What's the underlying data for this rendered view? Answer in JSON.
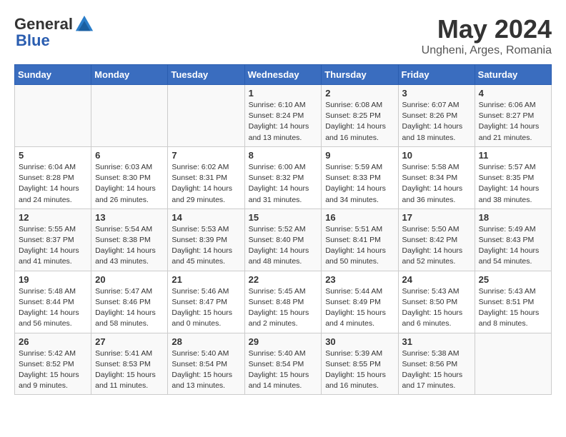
{
  "logo": {
    "general": "General",
    "blue": "Blue"
  },
  "title": "May 2024",
  "location": "Ungheni, Arges, Romania",
  "headers": [
    "Sunday",
    "Monday",
    "Tuesday",
    "Wednesday",
    "Thursday",
    "Friday",
    "Saturday"
  ],
  "weeks": [
    [
      {
        "num": "",
        "info": ""
      },
      {
        "num": "",
        "info": ""
      },
      {
        "num": "",
        "info": ""
      },
      {
        "num": "1",
        "info": "Sunrise: 6:10 AM\nSunset: 8:24 PM\nDaylight: 14 hours\nand 13 minutes."
      },
      {
        "num": "2",
        "info": "Sunrise: 6:08 AM\nSunset: 8:25 PM\nDaylight: 14 hours\nand 16 minutes."
      },
      {
        "num": "3",
        "info": "Sunrise: 6:07 AM\nSunset: 8:26 PM\nDaylight: 14 hours\nand 18 minutes."
      },
      {
        "num": "4",
        "info": "Sunrise: 6:06 AM\nSunset: 8:27 PM\nDaylight: 14 hours\nand 21 minutes."
      }
    ],
    [
      {
        "num": "5",
        "info": "Sunrise: 6:04 AM\nSunset: 8:28 PM\nDaylight: 14 hours\nand 24 minutes."
      },
      {
        "num": "6",
        "info": "Sunrise: 6:03 AM\nSunset: 8:30 PM\nDaylight: 14 hours\nand 26 minutes."
      },
      {
        "num": "7",
        "info": "Sunrise: 6:02 AM\nSunset: 8:31 PM\nDaylight: 14 hours\nand 29 minutes."
      },
      {
        "num": "8",
        "info": "Sunrise: 6:00 AM\nSunset: 8:32 PM\nDaylight: 14 hours\nand 31 minutes."
      },
      {
        "num": "9",
        "info": "Sunrise: 5:59 AM\nSunset: 8:33 PM\nDaylight: 14 hours\nand 34 minutes."
      },
      {
        "num": "10",
        "info": "Sunrise: 5:58 AM\nSunset: 8:34 PM\nDaylight: 14 hours\nand 36 minutes."
      },
      {
        "num": "11",
        "info": "Sunrise: 5:57 AM\nSunset: 8:35 PM\nDaylight: 14 hours\nand 38 minutes."
      }
    ],
    [
      {
        "num": "12",
        "info": "Sunrise: 5:55 AM\nSunset: 8:37 PM\nDaylight: 14 hours\nand 41 minutes."
      },
      {
        "num": "13",
        "info": "Sunrise: 5:54 AM\nSunset: 8:38 PM\nDaylight: 14 hours\nand 43 minutes."
      },
      {
        "num": "14",
        "info": "Sunrise: 5:53 AM\nSunset: 8:39 PM\nDaylight: 14 hours\nand 45 minutes."
      },
      {
        "num": "15",
        "info": "Sunrise: 5:52 AM\nSunset: 8:40 PM\nDaylight: 14 hours\nand 48 minutes."
      },
      {
        "num": "16",
        "info": "Sunrise: 5:51 AM\nSunset: 8:41 PM\nDaylight: 14 hours\nand 50 minutes."
      },
      {
        "num": "17",
        "info": "Sunrise: 5:50 AM\nSunset: 8:42 PM\nDaylight: 14 hours\nand 52 minutes."
      },
      {
        "num": "18",
        "info": "Sunrise: 5:49 AM\nSunset: 8:43 PM\nDaylight: 14 hours\nand 54 minutes."
      }
    ],
    [
      {
        "num": "19",
        "info": "Sunrise: 5:48 AM\nSunset: 8:44 PM\nDaylight: 14 hours\nand 56 minutes."
      },
      {
        "num": "20",
        "info": "Sunrise: 5:47 AM\nSunset: 8:46 PM\nDaylight: 14 hours\nand 58 minutes."
      },
      {
        "num": "21",
        "info": "Sunrise: 5:46 AM\nSunset: 8:47 PM\nDaylight: 15 hours\nand 0 minutes."
      },
      {
        "num": "22",
        "info": "Sunrise: 5:45 AM\nSunset: 8:48 PM\nDaylight: 15 hours\nand 2 minutes."
      },
      {
        "num": "23",
        "info": "Sunrise: 5:44 AM\nSunset: 8:49 PM\nDaylight: 15 hours\nand 4 minutes."
      },
      {
        "num": "24",
        "info": "Sunrise: 5:43 AM\nSunset: 8:50 PM\nDaylight: 15 hours\nand 6 minutes."
      },
      {
        "num": "25",
        "info": "Sunrise: 5:43 AM\nSunset: 8:51 PM\nDaylight: 15 hours\nand 8 minutes."
      }
    ],
    [
      {
        "num": "26",
        "info": "Sunrise: 5:42 AM\nSunset: 8:52 PM\nDaylight: 15 hours\nand 9 minutes."
      },
      {
        "num": "27",
        "info": "Sunrise: 5:41 AM\nSunset: 8:53 PM\nDaylight: 15 hours\nand 11 minutes."
      },
      {
        "num": "28",
        "info": "Sunrise: 5:40 AM\nSunset: 8:54 PM\nDaylight: 15 hours\nand 13 minutes."
      },
      {
        "num": "29",
        "info": "Sunrise: 5:40 AM\nSunset: 8:54 PM\nDaylight: 15 hours\nand 14 minutes."
      },
      {
        "num": "30",
        "info": "Sunrise: 5:39 AM\nSunset: 8:55 PM\nDaylight: 15 hours\nand 16 minutes."
      },
      {
        "num": "31",
        "info": "Sunrise: 5:38 AM\nSunset: 8:56 PM\nDaylight: 15 hours\nand 17 minutes."
      },
      {
        "num": "",
        "info": ""
      }
    ]
  ]
}
